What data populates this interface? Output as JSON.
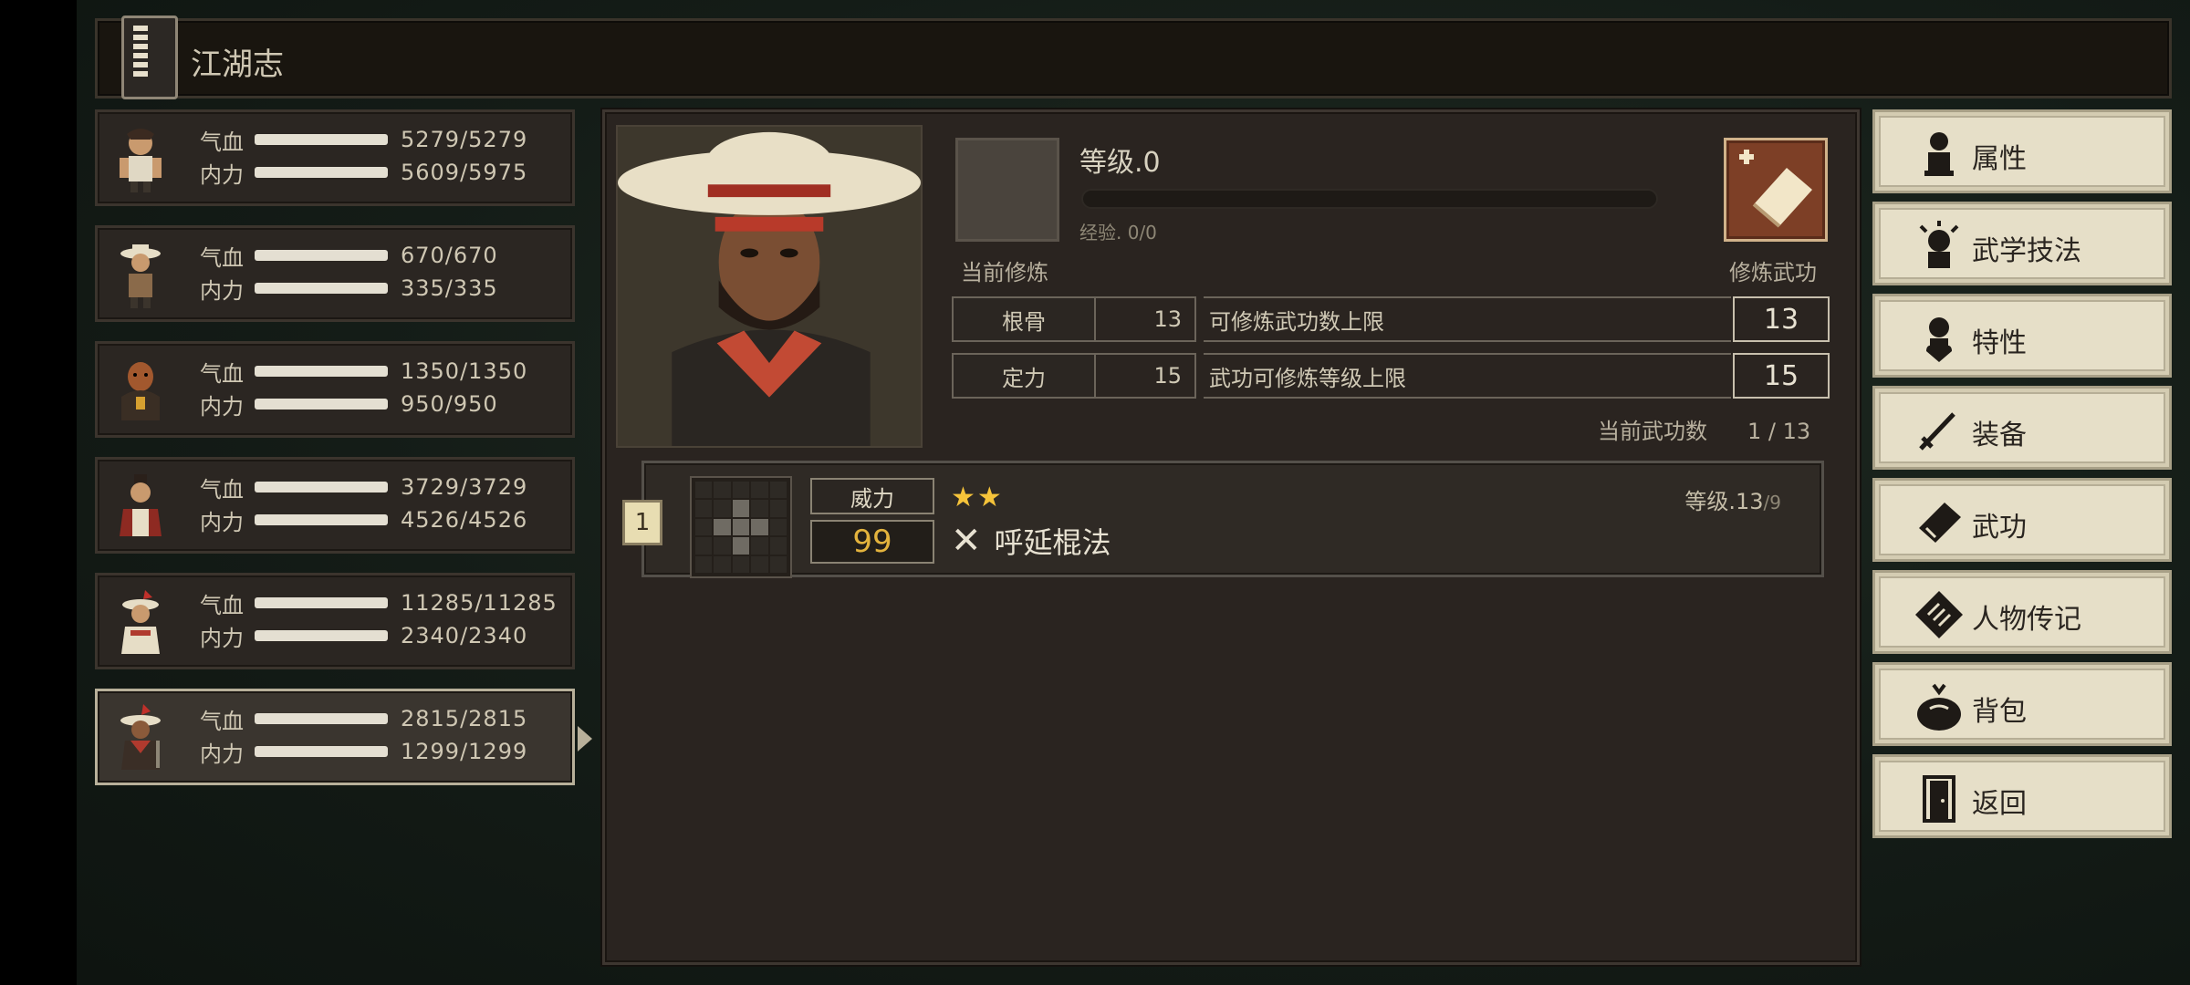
{
  "header": {
    "title": "江湖志",
    "icon": "scroll-book-icon"
  },
  "party": [
    {
      "hp_label": "气血",
      "mp_label": "内力",
      "hp": "5279/5279",
      "mp": "5609/5975",
      "selected": false
    },
    {
      "hp_label": "气血",
      "mp_label": "内力",
      "hp": "670/670",
      "mp": "335/335",
      "selected": false
    },
    {
      "hp_label": "气血",
      "mp_label": "内力",
      "hp": "1350/1350",
      "mp": "950/950",
      "selected": false
    },
    {
      "hp_label": "气血",
      "mp_label": "内力",
      "hp": "3729/3729",
      "mp": "4526/4526",
      "selected": false
    },
    {
      "hp_label": "气血",
      "mp_label": "内力",
      "hp": "11285/11285",
      "mp": "2340/2340",
      "selected": false
    },
    {
      "hp_label": "气血",
      "mp_label": "内力",
      "hp": "2815/2815",
      "mp": "1299/1299",
      "selected": true
    }
  ],
  "cultivation": {
    "current_label": "当前修炼",
    "level_label": "等级.0",
    "xp_label": "经验. 0/0",
    "xp_fraction": 0,
    "train_label": "修炼武功"
  },
  "attributes": [
    {
      "name": "根骨",
      "value": "13",
      "desc": "可修炼武功数上限",
      "cap": "13"
    },
    {
      "name": "定力",
      "value": "15",
      "desc": "武功可修炼等级上限",
      "cap": "15"
    }
  ],
  "martial_count": {
    "label": "当前武功数",
    "value": "1 / 13"
  },
  "skills": [
    {
      "index": "1",
      "power_label": "威力",
      "power": "99",
      "stars": "★★",
      "weapon_icon": "crossed-staff-icon",
      "name": "呼延棍法",
      "level_main": "等级.13",
      "level_max": "/9"
    }
  ],
  "menu": [
    {
      "label": "属性",
      "icon": "person-icon"
    },
    {
      "label": "武学技法",
      "icon": "spark-person-icon"
    },
    {
      "label": "特性",
      "icon": "heart-person-icon"
    },
    {
      "label": "装备",
      "icon": "sword-icon"
    },
    {
      "label": "武功",
      "icon": "manual-book-icon"
    },
    {
      "label": "人物传记",
      "icon": "biography-icon"
    },
    {
      "label": "背包",
      "icon": "bag-icon"
    },
    {
      "label": "返回",
      "icon": "door-icon"
    }
  ],
  "colors": {
    "accent_gold": "#e3b33d",
    "star": "#f5c33a",
    "menu_bg": "#e6dfc8",
    "panel_bg": "#2a2420"
  }
}
